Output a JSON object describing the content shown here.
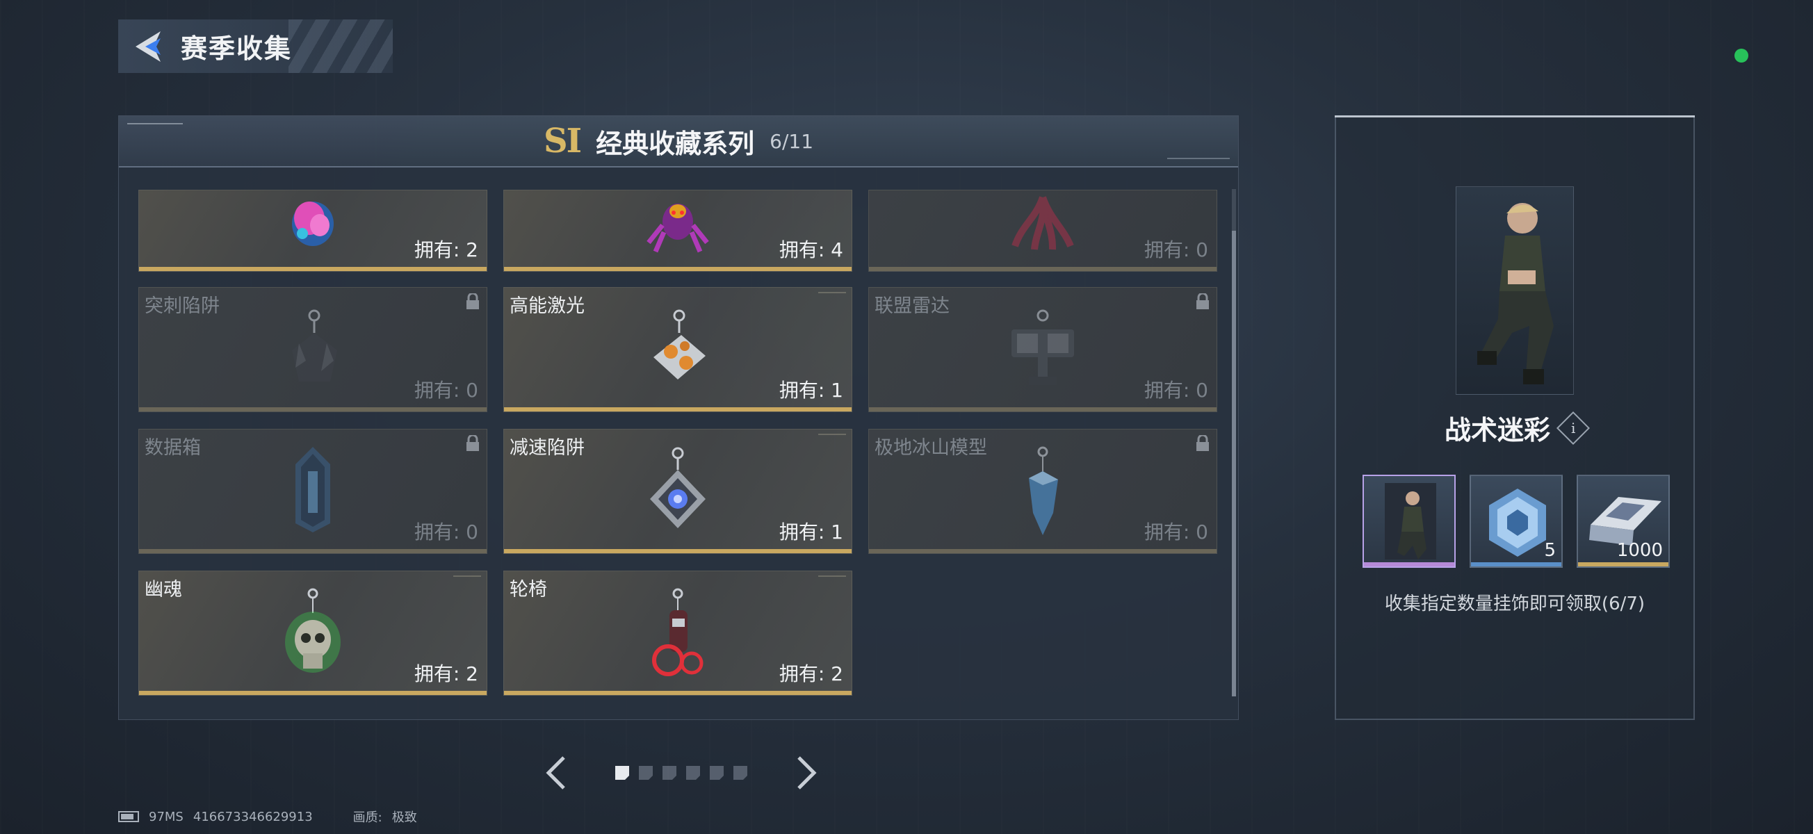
{
  "header": {
    "title": "赛季收集"
  },
  "series": {
    "badge": "SI",
    "title": "经典收藏系列",
    "count": "6/11"
  },
  "items": [
    {
      "name": "",
      "owned_label": "拥有: 2",
      "locked": false,
      "icon": "pink-heart-charm-icon"
    },
    {
      "name": "",
      "owned_label": "拥有: 4",
      "locked": false,
      "icon": "purple-spider-charm-icon"
    },
    {
      "name": "",
      "owned_label": "拥有: 0",
      "locked": true,
      "icon": "red-tentacle-charm-icon"
    },
    {
      "name": "突刺陷阱",
      "owned_label": "拥有: 0",
      "locked": true,
      "icon": "spike-trap-charm-icon"
    },
    {
      "name": "高能激光",
      "owned_label": "拥有: 1",
      "locked": false,
      "icon": "laser-charm-icon"
    },
    {
      "name": "联盟雷达",
      "owned_label": "拥有: 0",
      "locked": true,
      "icon": "radar-charm-icon"
    },
    {
      "name": "数据箱",
      "owned_label": "拥有: 0",
      "locked": true,
      "icon": "data-box-charm-icon"
    },
    {
      "name": "减速陷阱",
      "owned_label": "拥有: 1",
      "locked": false,
      "icon": "slow-trap-charm-icon"
    },
    {
      "name": "极地冰山模型",
      "owned_label": "拥有: 0",
      "locked": true,
      "icon": "iceberg-charm-icon"
    },
    {
      "name": "幽魂",
      "owned_label": "拥有: 2",
      "locked": false,
      "icon": "ghost-skull-charm-icon"
    },
    {
      "name": "轮椅",
      "owned_label": "拥有: 2",
      "locked": false,
      "icon": "wheelchair-charm-icon"
    }
  ],
  "pagination": {
    "total_pages": 6,
    "current_page": 1
  },
  "reward": {
    "name": "战术迷彩",
    "info_label": "i",
    "slots": [
      {
        "icon": "character-skin-icon",
        "qty": "",
        "bar_color": "#b58ad8"
      },
      {
        "icon": "crystal-box-icon",
        "qty": "5",
        "bar_color": "#5a8fc8"
      },
      {
        "icon": "ticket-icon",
        "qty": "1000",
        "bar_color": "#c9a860"
      }
    ],
    "description": "收集指定数量挂饰即可领取(6/7)"
  },
  "footer": {
    "ping": "97MS",
    "uid": "416673346629913",
    "quality_label": "画质:",
    "quality_value": "极致"
  },
  "colors": {
    "gold_bar": "#c9a860",
    "status_dot": "#28c15a",
    "accent_gold": "#d8b866"
  }
}
